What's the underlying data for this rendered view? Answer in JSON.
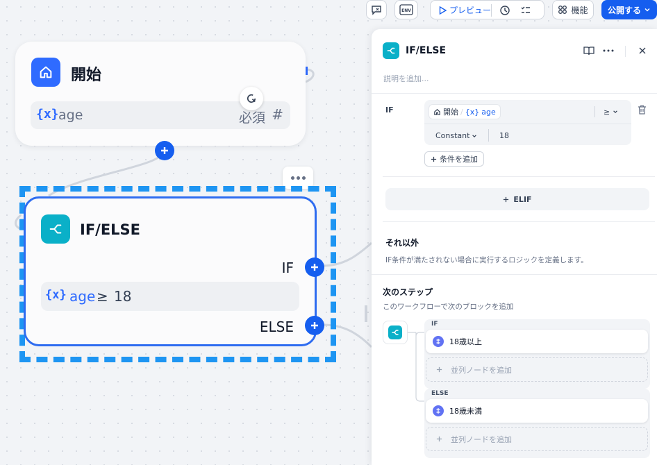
{
  "toolbar": {
    "preview_label": "プレビュー",
    "features_label": "機能",
    "publish_label": "公開する",
    "env_label": "ENV"
  },
  "canvas": {
    "start_node": {
      "title": "開始",
      "variable": "age",
      "required_label": "必須",
      "type_symbol": "#",
      "var_brace": "{x}"
    },
    "ifelse_node": {
      "title": "IF/ELSE",
      "if_label": "IF",
      "else_label": "ELSE",
      "condition": {
        "brace": "{x}",
        "variable": "age",
        "operator": "≥",
        "value": "18"
      }
    }
  },
  "panel": {
    "title": "IF/ELSE",
    "description_placeholder": "説明を追加...",
    "if_label": "IF",
    "condition": {
      "source_node": "開始",
      "separator": "/",
      "brace": "{x}",
      "variable": "age",
      "operator": "≥",
      "value_type": "Constant",
      "value": "18"
    },
    "add_condition_label": "条件を追加",
    "elif_label": "ELIF",
    "else_heading": "それ以外",
    "else_description": "IF条件が満たされない場合に実行するロジックを定義します。",
    "next_step_heading": "次のステップ",
    "next_step_description": "このワークフローで次のブロックを追加",
    "branches": [
      {
        "label": "IF",
        "node": "18歳以上",
        "add_label": "並列ノードを追加"
      },
      {
        "label": "ELSE",
        "node": "18歳未満",
        "add_label": "並列ノードを追加"
      }
    ]
  },
  "colors": {
    "accent": "#155eef",
    "ifelse_icon": "#0ab0c8",
    "selection": "#1e95f2"
  }
}
